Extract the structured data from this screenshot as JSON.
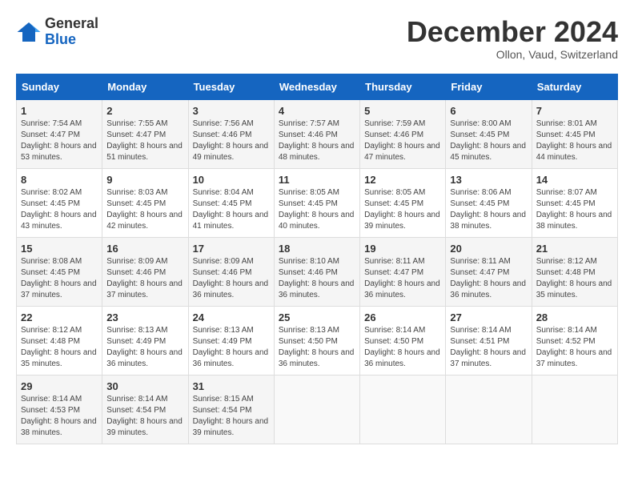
{
  "header": {
    "logo_general": "General",
    "logo_blue": "Blue",
    "month_title": "December 2024",
    "subtitle": "Ollon, Vaud, Switzerland"
  },
  "columns": [
    "Sunday",
    "Monday",
    "Tuesday",
    "Wednesday",
    "Thursday",
    "Friday",
    "Saturday"
  ],
  "weeks": [
    [
      {
        "day": "1",
        "sunrise": "Sunrise: 7:54 AM",
        "sunset": "Sunset: 4:47 PM",
        "daylight": "Daylight: 8 hours and 53 minutes."
      },
      {
        "day": "2",
        "sunrise": "Sunrise: 7:55 AM",
        "sunset": "Sunset: 4:47 PM",
        "daylight": "Daylight: 8 hours and 51 minutes."
      },
      {
        "day": "3",
        "sunrise": "Sunrise: 7:56 AM",
        "sunset": "Sunset: 4:46 PM",
        "daylight": "Daylight: 8 hours and 49 minutes."
      },
      {
        "day": "4",
        "sunrise": "Sunrise: 7:57 AM",
        "sunset": "Sunset: 4:46 PM",
        "daylight": "Daylight: 8 hours and 48 minutes."
      },
      {
        "day": "5",
        "sunrise": "Sunrise: 7:59 AM",
        "sunset": "Sunset: 4:46 PM",
        "daylight": "Daylight: 8 hours and 47 minutes."
      },
      {
        "day": "6",
        "sunrise": "Sunrise: 8:00 AM",
        "sunset": "Sunset: 4:45 PM",
        "daylight": "Daylight: 8 hours and 45 minutes."
      },
      {
        "day": "7",
        "sunrise": "Sunrise: 8:01 AM",
        "sunset": "Sunset: 4:45 PM",
        "daylight": "Daylight: 8 hours and 44 minutes."
      }
    ],
    [
      {
        "day": "8",
        "sunrise": "Sunrise: 8:02 AM",
        "sunset": "Sunset: 4:45 PM",
        "daylight": "Daylight: 8 hours and 43 minutes."
      },
      {
        "day": "9",
        "sunrise": "Sunrise: 8:03 AM",
        "sunset": "Sunset: 4:45 PM",
        "daylight": "Daylight: 8 hours and 42 minutes."
      },
      {
        "day": "10",
        "sunrise": "Sunrise: 8:04 AM",
        "sunset": "Sunset: 4:45 PM",
        "daylight": "Daylight: 8 hours and 41 minutes."
      },
      {
        "day": "11",
        "sunrise": "Sunrise: 8:05 AM",
        "sunset": "Sunset: 4:45 PM",
        "daylight": "Daylight: 8 hours and 40 minutes."
      },
      {
        "day": "12",
        "sunrise": "Sunrise: 8:05 AM",
        "sunset": "Sunset: 4:45 PM",
        "daylight": "Daylight: 8 hours and 39 minutes."
      },
      {
        "day": "13",
        "sunrise": "Sunrise: 8:06 AM",
        "sunset": "Sunset: 4:45 PM",
        "daylight": "Daylight: 8 hours and 38 minutes."
      },
      {
        "day": "14",
        "sunrise": "Sunrise: 8:07 AM",
        "sunset": "Sunset: 4:45 PM",
        "daylight": "Daylight: 8 hours and 38 minutes."
      }
    ],
    [
      {
        "day": "15",
        "sunrise": "Sunrise: 8:08 AM",
        "sunset": "Sunset: 4:45 PM",
        "daylight": "Daylight: 8 hours and 37 minutes."
      },
      {
        "day": "16",
        "sunrise": "Sunrise: 8:09 AM",
        "sunset": "Sunset: 4:46 PM",
        "daylight": "Daylight: 8 hours and 37 minutes."
      },
      {
        "day": "17",
        "sunrise": "Sunrise: 8:09 AM",
        "sunset": "Sunset: 4:46 PM",
        "daylight": "Daylight: 8 hours and 36 minutes."
      },
      {
        "day": "18",
        "sunrise": "Sunrise: 8:10 AM",
        "sunset": "Sunset: 4:46 PM",
        "daylight": "Daylight: 8 hours and 36 minutes."
      },
      {
        "day": "19",
        "sunrise": "Sunrise: 8:11 AM",
        "sunset": "Sunset: 4:47 PM",
        "daylight": "Daylight: 8 hours and 36 minutes."
      },
      {
        "day": "20",
        "sunrise": "Sunrise: 8:11 AM",
        "sunset": "Sunset: 4:47 PM",
        "daylight": "Daylight: 8 hours and 36 minutes."
      },
      {
        "day": "21",
        "sunrise": "Sunrise: 8:12 AM",
        "sunset": "Sunset: 4:48 PM",
        "daylight": "Daylight: 8 hours and 35 minutes."
      }
    ],
    [
      {
        "day": "22",
        "sunrise": "Sunrise: 8:12 AM",
        "sunset": "Sunset: 4:48 PM",
        "daylight": "Daylight: 8 hours and 35 minutes."
      },
      {
        "day": "23",
        "sunrise": "Sunrise: 8:13 AM",
        "sunset": "Sunset: 4:49 PM",
        "daylight": "Daylight: 8 hours and 36 minutes."
      },
      {
        "day": "24",
        "sunrise": "Sunrise: 8:13 AM",
        "sunset": "Sunset: 4:49 PM",
        "daylight": "Daylight: 8 hours and 36 minutes."
      },
      {
        "day": "25",
        "sunrise": "Sunrise: 8:13 AM",
        "sunset": "Sunset: 4:50 PM",
        "daylight": "Daylight: 8 hours and 36 minutes."
      },
      {
        "day": "26",
        "sunrise": "Sunrise: 8:14 AM",
        "sunset": "Sunset: 4:50 PM",
        "daylight": "Daylight: 8 hours and 36 minutes."
      },
      {
        "day": "27",
        "sunrise": "Sunrise: 8:14 AM",
        "sunset": "Sunset: 4:51 PM",
        "daylight": "Daylight: 8 hours and 37 minutes."
      },
      {
        "day": "28",
        "sunrise": "Sunrise: 8:14 AM",
        "sunset": "Sunset: 4:52 PM",
        "daylight": "Daylight: 8 hours and 37 minutes."
      }
    ],
    [
      {
        "day": "29",
        "sunrise": "Sunrise: 8:14 AM",
        "sunset": "Sunset: 4:53 PM",
        "daylight": "Daylight: 8 hours and 38 minutes."
      },
      {
        "day": "30",
        "sunrise": "Sunrise: 8:14 AM",
        "sunset": "Sunset: 4:54 PM",
        "daylight": "Daylight: 8 hours and 39 minutes."
      },
      {
        "day": "31",
        "sunrise": "Sunrise: 8:15 AM",
        "sunset": "Sunset: 4:54 PM",
        "daylight": "Daylight: 8 hours and 39 minutes."
      },
      null,
      null,
      null,
      null
    ]
  ]
}
